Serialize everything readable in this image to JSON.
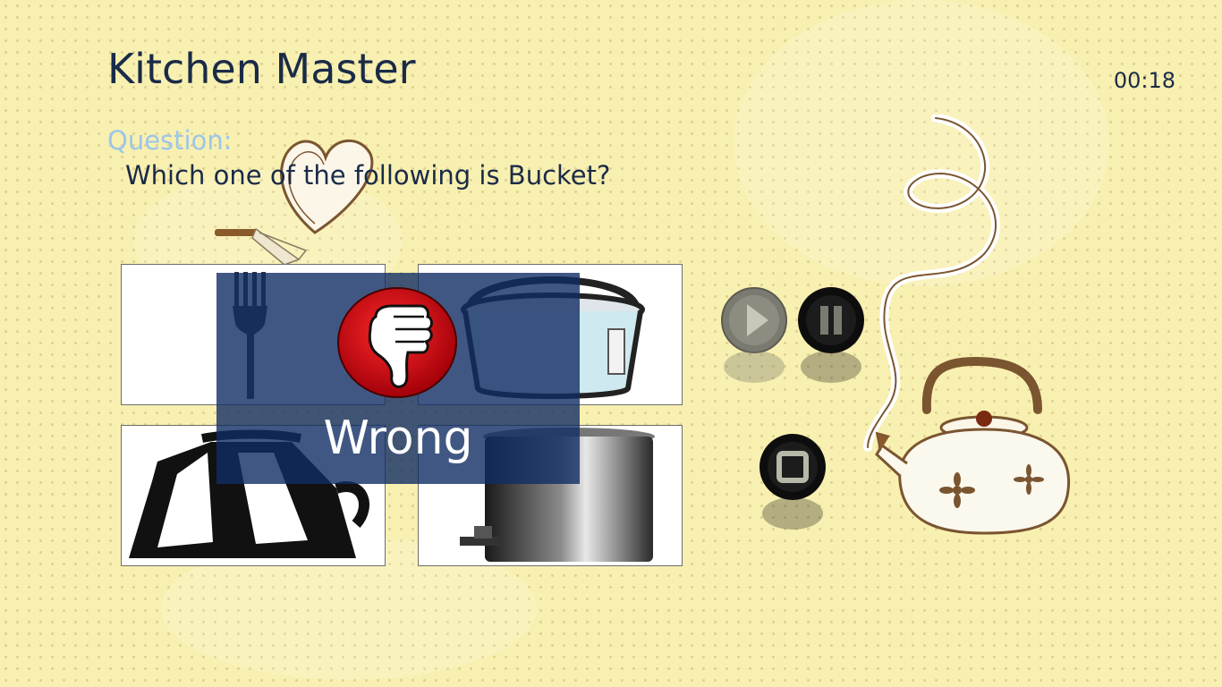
{
  "app": {
    "title": "Kitchen Master",
    "timer": "00:18"
  },
  "question": {
    "label": "Question:",
    "text": "Which one of the following is Bucket?"
  },
  "options": [
    {
      "name": "fork-option",
      "icon": "fork"
    },
    {
      "name": "bucket-option",
      "icon": "bucket"
    },
    {
      "name": "kettle-option",
      "icon": "kettle"
    },
    {
      "name": "trash-can-option",
      "icon": "trash-can"
    }
  ],
  "result": {
    "text": "Wrong",
    "icon": "thumbs-down-icon",
    "badge_color": "#c8101a"
  },
  "controls": {
    "play": "play-icon",
    "pause": "pause-icon",
    "stop": "stop-icon"
  },
  "colors": {
    "background": "#f8f0b0",
    "title": "#1a2b48",
    "question_label": "#9cc6ea",
    "overlay": "#112d64"
  }
}
